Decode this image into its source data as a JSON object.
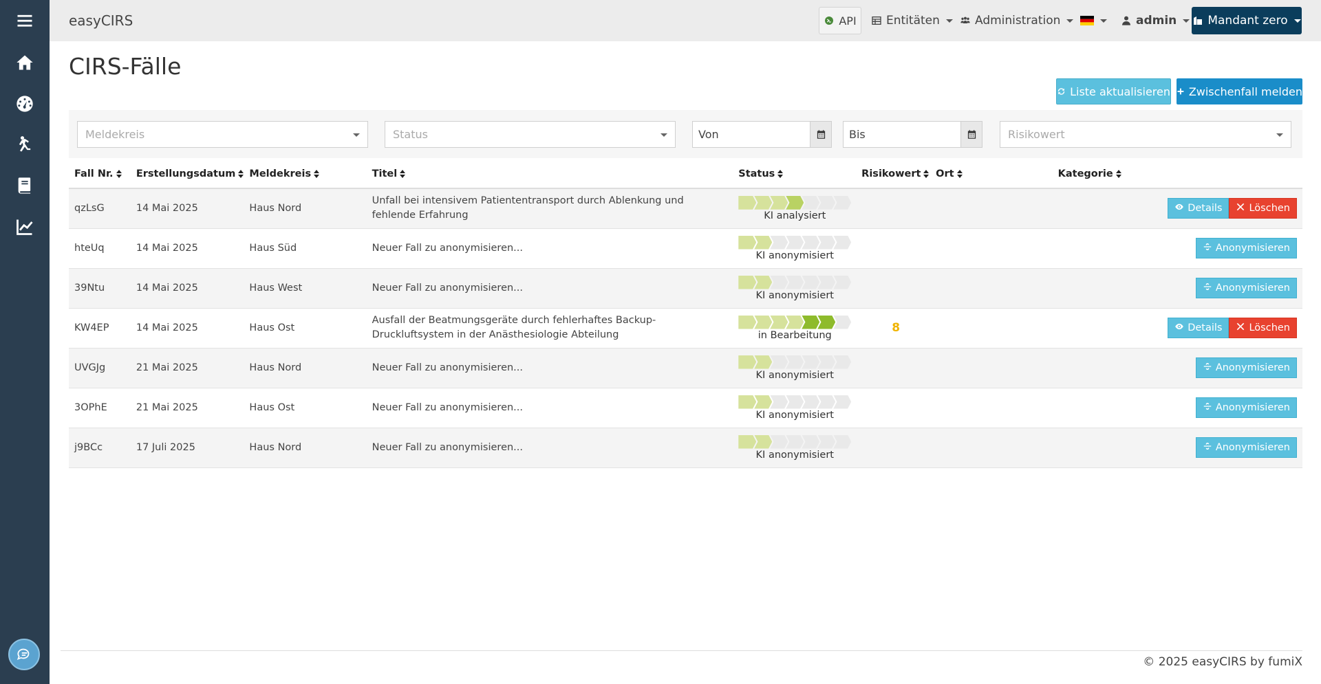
{
  "app": {
    "brand": "easyCIRS"
  },
  "topnav": {
    "api": "API",
    "entities": "Entitäten",
    "administration": "Administration",
    "language_flag": "de",
    "user": "admin",
    "tenant": "Mandant zero"
  },
  "sidebar": {
    "items": [
      {
        "icon": "menu-icon"
      },
      {
        "icon": "home-icon"
      },
      {
        "icon": "dashboard-icon"
      },
      {
        "icon": "falling-person-icon"
      },
      {
        "icon": "book-icon"
      },
      {
        "icon": "chart-line-icon"
      }
    ],
    "chat_icon": "chat-bubble-icon"
  },
  "page": {
    "title": "CIRS-Fälle",
    "refresh_label": "Liste aktualisieren",
    "report_label": "Zwischenfall melden"
  },
  "filters": {
    "meldekreis_placeholder": "Meldekreis",
    "status_placeholder": "Status",
    "von": "Von",
    "bis": "Bis",
    "risikowert_placeholder": "Risikowert"
  },
  "table": {
    "columns": [
      "Fall Nr.",
      "Erstellungsdatum",
      "Meldekreis",
      "Titel",
      "Status",
      "Risikowert",
      "Ort",
      "Kategorie"
    ],
    "rows": [
      {
        "fall": "qzLsG",
        "datum": "14 Mai 2025",
        "meldekreis": "Haus Nord",
        "titel": "Unfall bei intensivem Patiententransport durch Ablenkung und fehlende Erfahrung",
        "status": "KI analysiert",
        "progress_steps": 4,
        "risk": "",
        "ort": "",
        "kategorie": "",
        "actions": [
          "Details",
          "Löschen"
        ]
      },
      {
        "fall": "hteUq",
        "datum": "14 Mai 2025",
        "meldekreis": "Haus Süd",
        "titel": "Neuer Fall zu anonymisieren...",
        "status": "KI anonymisiert",
        "progress_steps": 2,
        "risk": "",
        "ort": "",
        "kategorie": "",
        "actions": [
          "Anonymisieren"
        ]
      },
      {
        "fall": "39Ntu",
        "datum": "14 Mai 2025",
        "meldekreis": "Haus West",
        "titel": "Neuer Fall zu anonymisieren...",
        "status": "KI anonymisiert",
        "progress_steps": 2,
        "risk": "",
        "ort": "",
        "kategorie": "",
        "actions": [
          "Anonymisieren"
        ]
      },
      {
        "fall": "KW4EP",
        "datum": "14 Mai 2025",
        "meldekreis": "Haus Ost",
        "titel": "Ausfall der Beatmungsgeräte durch fehlerhaftes Backup-Druckluftsystem in der Anästhesiologie Abteilung",
        "status": "in Bearbeitung",
        "progress_steps": 6,
        "risk": "8",
        "ort": "",
        "kategorie": "",
        "actions": [
          "Details",
          "Löschen"
        ]
      },
      {
        "fall": "UVGJg",
        "datum": "21 Mai 2025",
        "meldekreis": "Haus Nord",
        "titel": "Neuer Fall zu anonymisieren...",
        "status": "KI anonymisiert",
        "progress_steps": 2,
        "risk": "",
        "ort": "",
        "kategorie": "",
        "actions": [
          "Anonymisieren"
        ]
      },
      {
        "fall": "3OPhE",
        "datum": "21 Mai 2025",
        "meldekreis": "Haus Ost",
        "titel": "Neuer Fall zu anonymisieren...",
        "status": "KI anonymisiert",
        "progress_steps": 2,
        "risk": "",
        "ort": "",
        "kategorie": "",
        "actions": [
          "Anonymisieren"
        ]
      },
      {
        "fall": "j9BCc",
        "datum": "17 Juli 2025",
        "meldekreis": "Haus Nord",
        "titel": "Neuer Fall zu anonymisieren...",
        "status": "KI anonymisiert",
        "progress_steps": 2,
        "risk": "",
        "ort": "",
        "kategorie": "",
        "actions": [
          "Anonymisieren"
        ]
      }
    ],
    "progress_total": 7
  },
  "footer": {
    "text": "© 2025 easyCIRS by fumiX"
  },
  "colors": {
    "sidebar": "#2b3e50",
    "tenant": "#0b3d5c",
    "info": "#5bc0de",
    "primary": "#1a8dc9",
    "danger": "#e8422f",
    "risk": "#f0b400"
  }
}
